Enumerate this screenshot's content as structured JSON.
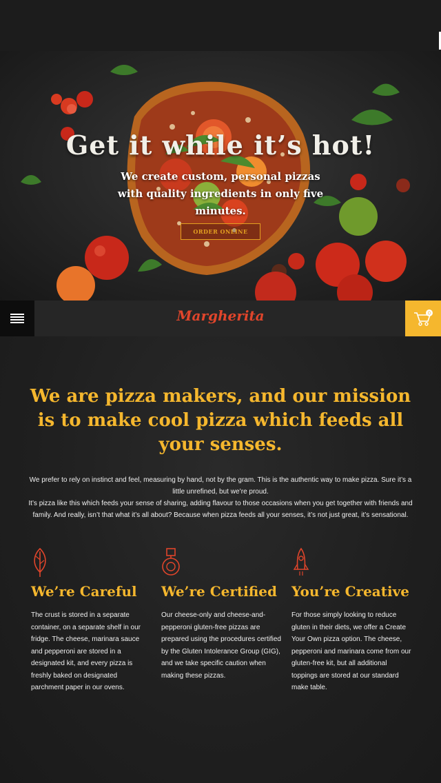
{
  "hero": {
    "title": "Get it while it’s hot!",
    "subtitle": "We create custom, personal pizzas with quality ingredients in only five minutes.",
    "cta_label": "ORDER ONLINE"
  },
  "nav": {
    "menu_icon": "hamburger-icon",
    "logo": "Margherita",
    "cart_icon": "cart-icon",
    "cart_count": "0"
  },
  "mission": {
    "heading": "We are pizza makers, and our mission is to make cool pizza which feeds all your senses.",
    "paragraph_1": "We prefer to rely on instinct and feel, measuring by hand, not by the gram. This is the authentic way to make pizza. Sure it’s a little unrefined, but we’re proud.",
    "paragraph_2": "It’s pizza like this which feeds your sense of sharing, adding flavour to those occasions when you get together with friends and family. And really, isn’t that what it’s all about? Because when pizza feeds all your senses, it’s not just great, it’s sensational."
  },
  "features": [
    {
      "icon": "leaf-icon",
      "title": "We’re Careful",
      "text": "The crust is stored in a separate container, on a separate shelf in our fridge. The cheese, marinara sauce and pepperoni are stored in a designated kit, and every pizza is freshly baked on designated parchment paper in our ovens."
    },
    {
      "icon": "medal-icon",
      "title": "We’re Certified",
      "text": "Our cheese-only and cheese-and-pepperoni gluten-free pizzas are prepared using the procedures certified by the Gluten Intolerance Group (GIG), and we take specific caution when making these pizzas."
    },
    {
      "icon": "rocket-icon",
      "title": "You’re Creative",
      "text": "For those simply looking to reduce gluten in their diets, we offer a Create Your Own pizza option. The cheese, pepperoni and marinara come from our gluten-free kit, but all additional toppings are stored at our standard make table."
    }
  ],
  "colors": {
    "accent": "#f5b72e",
    "logo": "#e0452b",
    "background": "#1c1c1c"
  }
}
